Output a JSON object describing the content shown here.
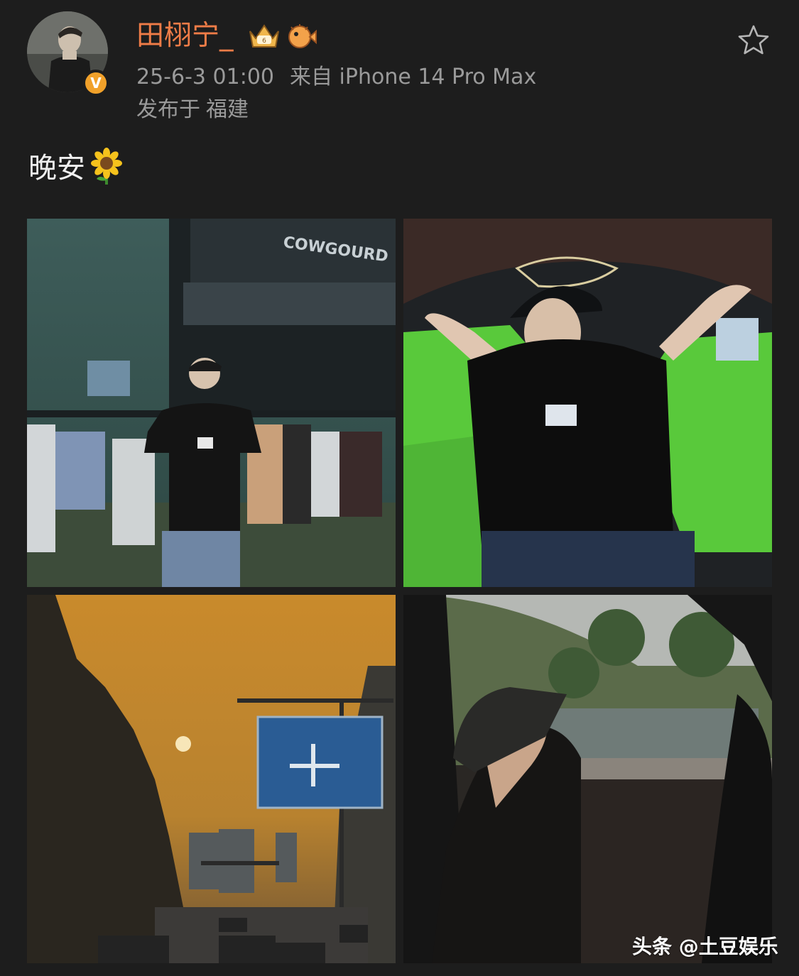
{
  "post": {
    "username": "田栩宁_",
    "timestamp": "25-6-3 01:00",
    "source": "来自 iPhone 14 Pro Max",
    "location_prefix": "发布于",
    "location": "福建",
    "text": "晚安",
    "verified_mark": "V",
    "text_emoji": "sunflower-emoji",
    "badges": [
      "crown-badge-icon",
      "pufferfish-badge-icon"
    ],
    "favorite_icon": "star-outline-icon"
  },
  "images": [
    {
      "name": "concert-crowd-photo"
    },
    {
      "name": "inflatable-lounger-photo"
    },
    {
      "name": "sunset-street-photo"
    },
    {
      "name": "car-window-photo",
      "sign_text": "COWGOURD"
    }
  ],
  "watermark": "头条 @土豆娱乐",
  "colors": {
    "background": "#1d1d1d",
    "username": "#ef7c47",
    "meta": "#9a9a9a",
    "verified": "#f1a12a"
  }
}
